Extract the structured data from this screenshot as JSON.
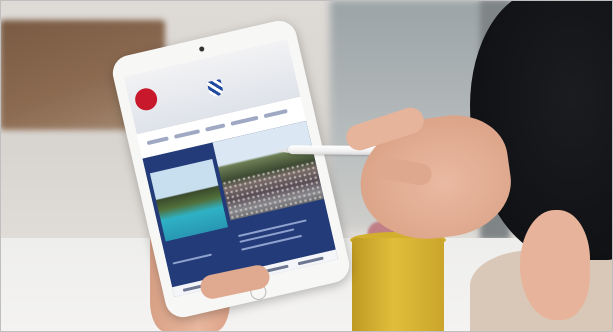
{
  "photo": {
    "subject": "",
    "screen_logo_text": "",
    "screen_logo_sub": "",
    "screen_tagline": "",
    "card_captions": [
      "",
      "",
      ""
    ]
  },
  "colors": {
    "site_navy": "#233b78",
    "logo_red": "#c8182b",
    "cup_yellow": "#e0be3b",
    "hair_black": "#121316"
  },
  "icons": [
    "tablet-camera-icon",
    "home-button-icon",
    "logo-crest-icon"
  ]
}
